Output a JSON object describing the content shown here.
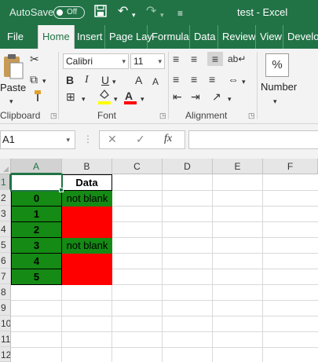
{
  "titlebar": {
    "autosave_label": "AutoSave",
    "autosave_state": "Off",
    "title": "test  -  Excel",
    "save_icon": "save-icon",
    "undo_icon": "undo-icon",
    "redo_icon": "redo-icon",
    "customize_icon": "customize-quick-access-icon"
  },
  "tabs": [
    "File",
    "Home",
    "Insert",
    "Page Lay",
    "Formula",
    "Data",
    "Review",
    "View",
    "Develop"
  ],
  "active_tab": "Home",
  "ribbon": {
    "clipboard": {
      "label": "Clipboard",
      "paste_label": "Paste"
    },
    "font": {
      "label": "Font",
      "font_name": "Calibri",
      "font_size": "11",
      "bold": "B",
      "italic": "I",
      "underline": "U",
      "grow": "A",
      "shrink": "A",
      "fill_color": "#ffff00",
      "font_color": "#ff0000"
    },
    "alignment": {
      "label": "Alignment"
    },
    "number": {
      "label": "Number",
      "percent": "%"
    }
  },
  "formula_bar": {
    "name_box": "A1",
    "formula": "",
    "cancel_icon": "cancel-icon",
    "enter_icon": "enter-icon",
    "fx_label": "fx"
  },
  "sheet": {
    "columns": [
      "A",
      "B",
      "C",
      "D",
      "E",
      "F"
    ],
    "selected_column": "A",
    "row_numbers": [
      "1",
      "2",
      "3",
      "4",
      "5",
      "6",
      "7",
      "8",
      "9",
      "10",
      "11",
      "12"
    ],
    "selected_row": "1",
    "header_B1": "Data",
    "col_a_values": [
      "0",
      "1",
      "2",
      "3",
      "4",
      "5"
    ],
    "col_b_values": [
      "not blank",
      "",
      "",
      "not blank",
      "",
      ""
    ],
    "colors": {
      "green": "#158a14",
      "red": "#ff0000",
      "accent": "#217346"
    }
  }
}
